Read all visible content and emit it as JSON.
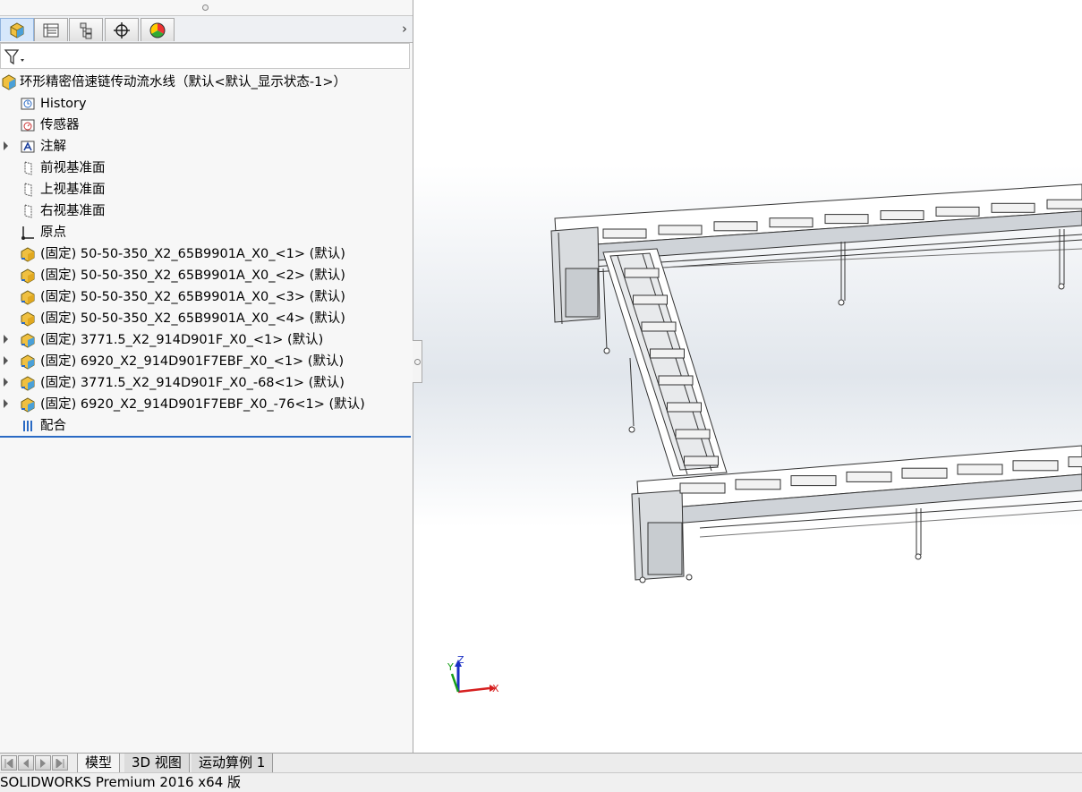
{
  "panel": {
    "tabs": [
      {
        "icon": "featuremanager-icon"
      },
      {
        "icon": "propertymanager-icon"
      },
      {
        "icon": "configurationmanager-icon"
      },
      {
        "icon": "dimxpert-icon"
      },
      {
        "icon": "displaymanager-icon"
      }
    ],
    "filter_icon": "filter-icon"
  },
  "tree": {
    "root": "环形精密倍速链传动流水线（默认<默认_显示状态-1>）",
    "items": [
      {
        "label": "History",
        "icon": "history-icon"
      },
      {
        "label": "传感器",
        "icon": "sensor-icon"
      },
      {
        "label": "注解",
        "icon": "annotation-icon",
        "expandable": true
      },
      {
        "label": "前视基准面",
        "icon": "plane-icon"
      },
      {
        "label": "上视基准面",
        "icon": "plane-icon"
      },
      {
        "label": "右视基准面",
        "icon": "plane-icon"
      },
      {
        "label": "原点",
        "icon": "origin-icon"
      },
      {
        "label": "(固定) 50-50-350_X2_65B9901A_X0_<1> (默认)",
        "icon": "part-icon"
      },
      {
        "label": "(固定) 50-50-350_X2_65B9901A_X0_<2> (默认)",
        "icon": "part-icon"
      },
      {
        "label": "(固定) 50-50-350_X2_65B9901A_X0_<3> (默认)",
        "icon": "part-icon"
      },
      {
        "label": "(固定) 50-50-350_X2_65B9901A_X0_<4> (默认)",
        "icon": "part-icon"
      },
      {
        "label": "(固定) 3771.5_X2_914D901F_X0_<1> (默认)",
        "icon": "subassembly-icon",
        "expandable": true
      },
      {
        "label": "(固定) 6920_X2_914D901F7EBF_X0_<1> (默认)",
        "icon": "subassembly-icon",
        "expandable": true
      },
      {
        "label": "(固定) 3771.5_X2_914D901F_X0_-68<1> (默认)",
        "icon": "subassembly-icon",
        "expandable": true
      },
      {
        "label": "(固定) 6920_X2_914D901F7EBF_X0_-76<1> (默认)",
        "icon": "subassembly-icon",
        "expandable": true
      },
      {
        "label": "配合",
        "icon": "mates-icon"
      }
    ]
  },
  "bottom_tabs": [
    "模型",
    "3D 视图",
    "运动算例 1"
  ],
  "status": {
    "text": "SOLIDWORKS Premium 2016 x64 版"
  },
  "triad": {
    "x": "X",
    "y": "Y",
    "z": "Z"
  }
}
